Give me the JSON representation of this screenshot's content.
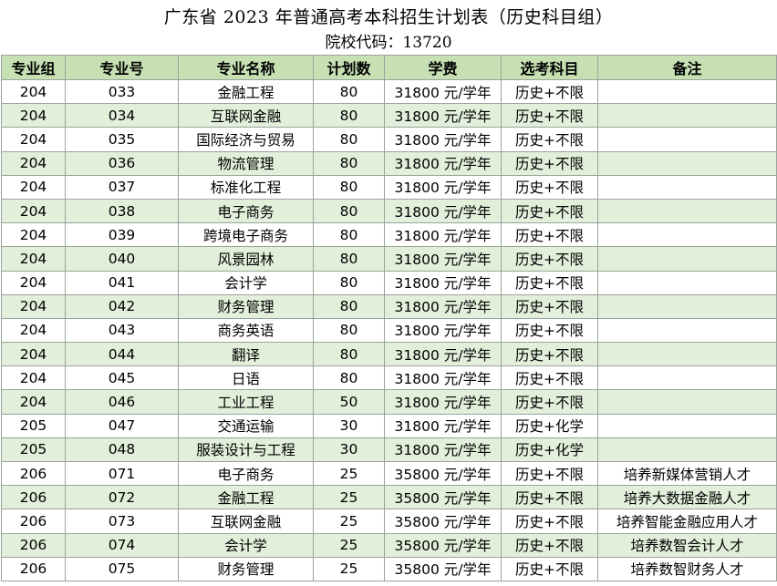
{
  "title": "广东省 2023 年普通高考本科招生计划表（历史科目组）",
  "subtitle": "院校代码：13720",
  "table": {
    "headers": [
      "专业组",
      "专业号",
      "专业名称",
      "计划数",
      "学费",
      "选考科目",
      "备注"
    ],
    "rows": [
      [
        "204",
        "033",
        "金融工程",
        "80",
        "31800 元/学年",
        "历史+不限",
        ""
      ],
      [
        "204",
        "034",
        "互联网金融",
        "80",
        "31800 元/学年",
        "历史+不限",
        ""
      ],
      [
        "204",
        "035",
        "国际经济与贸易",
        "80",
        "31800 元/学年",
        "历史+不限",
        ""
      ],
      [
        "204",
        "036",
        "物流管理",
        "80",
        "31800 元/学年",
        "历史+不限",
        ""
      ],
      [
        "204",
        "037",
        "标准化工程",
        "80",
        "31800 元/学年",
        "历史+不限",
        ""
      ],
      [
        "204",
        "038",
        "电子商务",
        "80",
        "31800 元/学年",
        "历史+不限",
        ""
      ],
      [
        "204",
        "039",
        "跨境电子商务",
        "80",
        "31800 元/学年",
        "历史+不限",
        ""
      ],
      [
        "204",
        "040",
        "风景园林",
        "80",
        "31800 元/学年",
        "历史+不限",
        ""
      ],
      [
        "204",
        "041",
        "会计学",
        "80",
        "31800 元/学年",
        "历史+不限",
        ""
      ],
      [
        "204",
        "042",
        "财务管理",
        "80",
        "31800 元/学年",
        "历史+不限",
        ""
      ],
      [
        "204",
        "043",
        "商务英语",
        "80",
        "31800 元/学年",
        "历史+不限",
        ""
      ],
      [
        "204",
        "044",
        "翻译",
        "80",
        "31800 元/学年",
        "历史+不限",
        ""
      ],
      [
        "204",
        "045",
        "日语",
        "80",
        "31800 元/学年",
        "历史+不限",
        ""
      ],
      [
        "204",
        "046",
        "工业工程",
        "50",
        "31800 元/学年",
        "历史+不限",
        ""
      ],
      [
        "205",
        "047",
        "交通运输",
        "30",
        "31800 元/学年",
        "历史+化学",
        ""
      ],
      [
        "205",
        "048",
        "服装设计与工程",
        "30",
        "31800 元/学年",
        "历史+化学",
        ""
      ],
      [
        "206",
        "071",
        "电子商务",
        "25",
        "35800 元/学年",
        "历史+不限",
        "培养新媒体营销人才"
      ],
      [
        "206",
        "072",
        "金融工程",
        "25",
        "35800 元/学年",
        "历史+不限",
        "培养大数据金融人才"
      ],
      [
        "206",
        "073",
        "互联网金融",
        "25",
        "35800 元/学年",
        "历史+不限",
        "培养智能金融应用人才"
      ],
      [
        "206",
        "074",
        "会计学",
        "25",
        "35800 元/学年",
        "历史+不限",
        "培养数智会计人才"
      ],
      [
        "206",
        "075",
        "财务管理",
        "25",
        "35800 元/学年",
        "历史+不限",
        "培养数智财务人才"
      ]
    ]
  }
}
